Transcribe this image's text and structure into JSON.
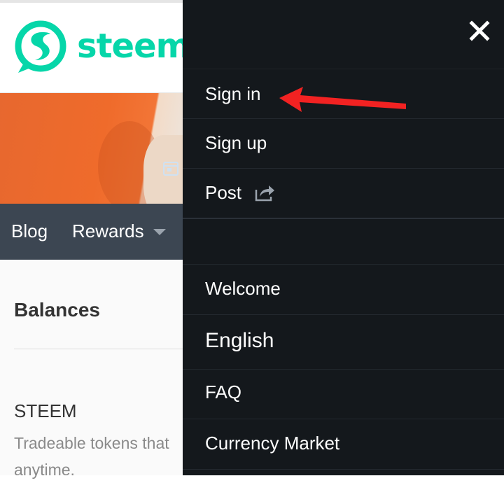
{
  "brand": {
    "logo_text": "steem",
    "accent_color": "#06d6a9"
  },
  "nav": {
    "blog_label": "Blog",
    "rewards_label": "Rewards"
  },
  "content": {
    "balances_title": "Balances",
    "steem_label": "STEEM",
    "steem_description_line1": "Tradeable tokens that",
    "steem_description_line2": "anytime."
  },
  "side_menu": {
    "close_icon": "close-icon",
    "background_color": "#14181c",
    "items": [
      {
        "label": "Sign in"
      },
      {
        "label": "Sign up"
      },
      {
        "label": "Post",
        "icon": "share-icon"
      },
      {
        "label": "Welcome"
      },
      {
        "label": "English"
      },
      {
        "label": "FAQ"
      },
      {
        "label": "Currency Market"
      }
    ]
  },
  "annotation": {
    "arrow_color": "#f22222",
    "arrow_target": "Sign in"
  }
}
